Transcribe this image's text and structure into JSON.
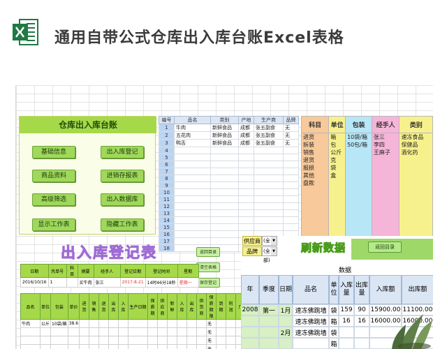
{
  "page_title": "通用自带公式仓库出入库台账Excel表格",
  "icon": "excel-logo-icon",
  "menu": {
    "title": "仓库出入库台账",
    "buttons": [
      "基础信息",
      "出入库登记",
      "商品资料",
      "进销存报表",
      "高级筛选",
      "出入数据库",
      "显示工作表",
      "隐藏工作表"
    ]
  },
  "product_table": {
    "headers": [
      "编号",
      "品名",
      "类别",
      "产地",
      "生产商",
      "品牌"
    ],
    "rows": [
      [
        "1",
        "牛肉",
        "新鲜食品",
        "成都",
        "张五副食",
        "无"
      ],
      [
        "2",
        "五花肉",
        "新鲜食品",
        "成都",
        "张五副食",
        "无"
      ],
      [
        "3",
        "鸭舌",
        "新鲜食品",
        "成都",
        "张五副食",
        "无"
      ],
      [
        "4",
        "",
        "",
        "",
        "",
        ""
      ],
      [
        "5",
        "",
        "",
        "",
        "",
        ""
      ],
      [
        "6",
        "",
        "",
        "",
        "",
        ""
      ],
      [
        "7",
        "",
        "",
        "",
        "",
        ""
      ],
      [
        "8",
        "",
        "",
        "",
        "",
        ""
      ],
      [
        "9",
        "",
        "",
        "",
        "",
        ""
      ],
      [
        "10",
        "",
        "",
        "",
        "",
        ""
      ],
      [
        "11",
        "",
        "",
        "",
        "",
        ""
      ],
      [
        "12",
        "",
        "",
        "",
        "",
        ""
      ],
      [
        "13",
        "",
        "",
        "",
        "",
        ""
      ],
      [
        "14",
        "",
        "",
        "",
        "",
        ""
      ],
      [
        "15",
        "",
        "",
        "",
        "",
        ""
      ],
      [
        "16",
        "",
        "",
        "",
        "",
        ""
      ],
      [
        "17",
        "",
        "",
        "",
        "",
        ""
      ],
      [
        "18",
        "",
        "",
        "",
        "",
        ""
      ]
    ]
  },
  "category_table": {
    "headers": [
      "科目",
      "单位",
      "包装",
      "经手人",
      "类别"
    ],
    "col1": [
      "进货",
      "拆装",
      "销售",
      "退货",
      "报损",
      "其他",
      "盘欺"
    ],
    "col2": [
      "箱",
      "包",
      "公斤",
      "克",
      "袋",
      "盒",
      ""
    ],
    "col3": [
      "10袋/箱",
      "50包/箱",
      "",
      "",
      "",
      "",
      ""
    ],
    "col4": [
      "张三",
      "李四",
      "王麻子",
      "",
      "",
      "",
      ""
    ],
    "col5": [
      "速冻食品",
      "保健品",
      "酒化药",
      "",
      "",
      "",
      ""
    ]
  },
  "register": {
    "title": "出入库登记表",
    "buttons": [
      "返回目录",
      "清空表格",
      "保存登记"
    ],
    "headers1": [
      "日期",
      "凭单号",
      "科目",
      "摘要",
      "经手人",
      "登记日期",
      "登记时间",
      "星期"
    ],
    "row1": [
      "2016/10/16",
      "1",
      "",
      "买牛肉",
      "张三",
      "2017-8-21",
      "14时46分18秒",
      "星期一"
    ],
    "headers2": [
      "品名",
      "单位",
      "包装",
      "单价",
      "进货",
      "销售",
      "退货",
      "出库",
      "入库",
      "生产日期",
      "保质期",
      "供应商",
      "新鲜",
      "入库",
      "出库",
      "供货商",
      "保质期限",
      "到期",
      "利润",
      "厂",
      "出",
      "数"
    ],
    "row2": [
      "牛肉",
      "公斤",
      "10袋/箱",
      "38.6"
    ],
    "side_marks": [
      "无",
      "无",
      "无",
      "无"
    ]
  },
  "pivot": {
    "filters": [
      {
        "label": "供应商",
        "value": "(全部)"
      },
      {
        "label": "品牌",
        "value": "(全部)"
      }
    ],
    "refresh_title": "刷新数据",
    "return_button": "返回目录",
    "data_label": "数据",
    "headers": [
      "年",
      "季度",
      "日期",
      "品名",
      "单位",
      "入库量",
      "出库量",
      "入库额",
      "出库额"
    ],
    "rows": [
      [
        "",
        "2008",
        "第一",
        "1月",
        "速冻佛跳墙",
        "袋",
        "159",
        "90",
        "15900.00",
        "11100.00"
      ],
      [
        "",
        "",
        "",
        "",
        "速冻佛跳墙",
        "箱",
        "16",
        "16",
        "16000.00",
        "16000.00"
      ],
      [
        "",
        "",
        "",
        "2月",
        "速冻佛跳墙",
        "袋",
        "",
        "",
        "",
        ""
      ],
      [
        "",
        "",
        "",
        "",
        "",
        "箱",
        "",
        "",
        "",
        ""
      ]
    ]
  }
}
